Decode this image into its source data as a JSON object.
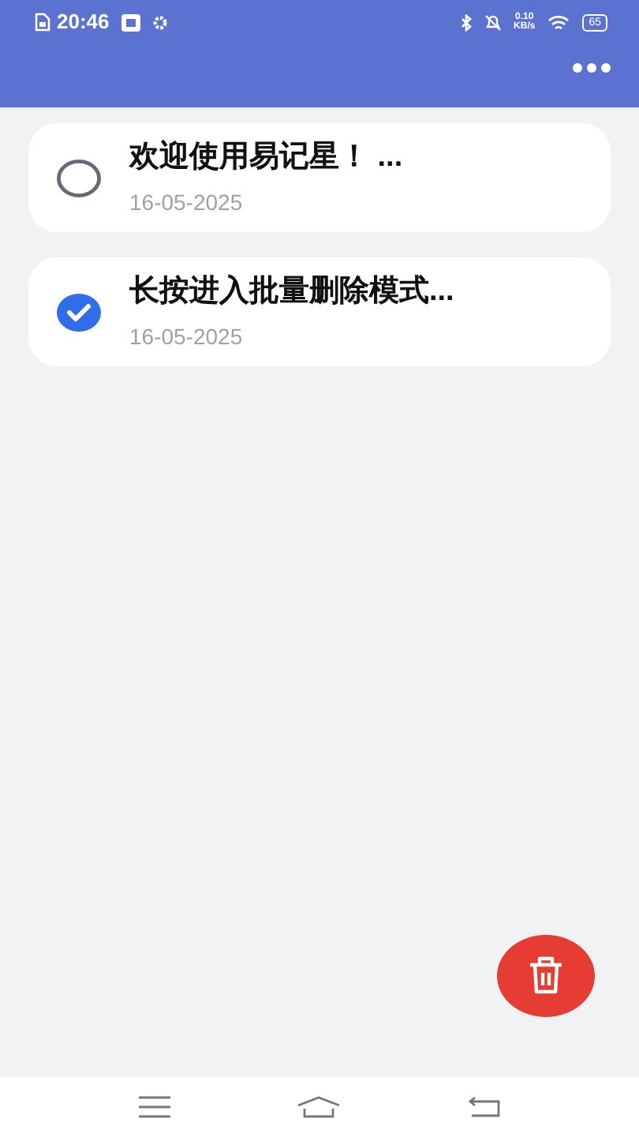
{
  "status_bar": {
    "time": "20:46",
    "net_speed": "0.10",
    "net_unit": "KB/s",
    "battery": "65"
  },
  "notes": [
    {
      "title": "欢迎使用易记星！ ...",
      "date": "16-05-2025",
      "checked": false
    },
    {
      "title": "长按进入批量删除模式...",
      "date": "16-05-2025",
      "checked": true
    }
  ]
}
